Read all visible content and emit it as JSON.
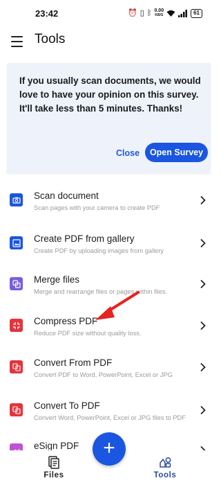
{
  "status_bar": {
    "time": "23:42",
    "speed_value": "0.00",
    "speed_unit": "KB/S",
    "battery": "61",
    "icons": [
      "alarm-icon",
      "vibrate-icon",
      "bluetooth-icon",
      "wifi-icon",
      "signal-icon",
      "battery-icon"
    ]
  },
  "app_bar": {
    "title": "Tools"
  },
  "survey": {
    "message": "If you usually scan documents, we would love to have your opinion on this survey. It'll take less than 5 minutes. Thanks!",
    "close_label": "Close",
    "open_label": "Open Survey"
  },
  "tools": [
    {
      "name": "Scan document",
      "description": "Scan pages with your camera to create PDF",
      "icon": "camera-icon",
      "color": "#1a56e0"
    },
    {
      "name": "Create PDF from gallery",
      "description": "Create PDF by uploading images from gallery",
      "icon": "image-icon",
      "color": "#1a56e0"
    },
    {
      "name": "Merge files",
      "description": "Merge and rearrange files or pages within files.",
      "icon": "merge-icon",
      "color": "#7b5ce0"
    },
    {
      "name": "Compress PDF",
      "description": "Reduce PDF size without quality loss.",
      "icon": "compress-icon",
      "color": "#e3343c"
    },
    {
      "name": "Convert From PDF",
      "description": "Convert PDF to Word, PowerPoint, Excel or JPG",
      "icon": "convert-from-icon",
      "color": "#e3343c"
    },
    {
      "name": "Convert To PDF",
      "description": "Convert Word, PowerPoint, Excel or JPG files to PDF",
      "icon": "convert-to-icon",
      "color": "#e3343c"
    },
    {
      "name": "eSign PDF",
      "description": "",
      "icon": "esign-icon",
      "color": "#c24fd8"
    }
  ],
  "fab": {
    "label": "+"
  },
  "bottom_nav": {
    "files_label": "Files",
    "tools_label": "Tools"
  },
  "colors": {
    "accent": "#1a56e0",
    "survey_bg": "#eef2fb",
    "annotation": "#e52420"
  }
}
